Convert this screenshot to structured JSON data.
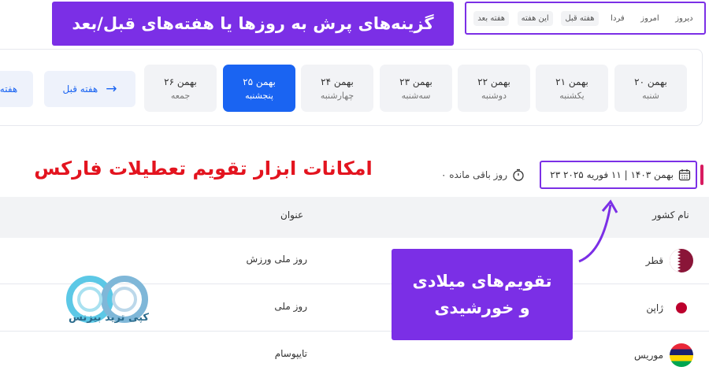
{
  "quick_nav": {
    "buttons": [
      "دیروز",
      "امروز",
      "فردا",
      "هفته قبل",
      "این هفته",
      "هفته بعد"
    ]
  },
  "callouts": {
    "top": "گزینه‌های پرش به روزها یا هفته‌های قبل/بعد",
    "calendar_line1": "تقویم‌های میلادی",
    "calendar_line2": "و خورشیدی",
    "features_title": "امکانات ابزار تقویم تعطیلات فارکس"
  },
  "days": [
    {
      "date": "۲۰ بهمن",
      "weekday": "شنبه"
    },
    {
      "date": "۲۱ بهمن",
      "weekday": "یکشنبه"
    },
    {
      "date": "۲۲ بهمن",
      "weekday": "دوشنبه"
    },
    {
      "date": "۲۳ بهمن",
      "weekday": "سه‌شنبه"
    },
    {
      "date": "۲۴ بهمن",
      "weekday": "چهارشنبه"
    },
    {
      "date": "۲۵ بهمن",
      "weekday": "پنجشنبه",
      "active": true
    },
    {
      "date": "۲۶ بهمن",
      "weekday": "جمعه"
    }
  ],
  "week_nav": {
    "prev_label": "هفته قبل",
    "next_label": "هفته"
  },
  "date_header": {
    "text": "۲۳ بهمن ۱۴۰۳ | ۱۱ فوریه ۲۰۲۵",
    "remaining": "۰ روز باقی مانده"
  },
  "table": {
    "col_country": "نام کشور",
    "col_title": "عنوان",
    "rows": [
      {
        "country": "قطر",
        "title": "روز ملی ورزش"
      },
      {
        "country": "ژاپن",
        "title": "روز ملی"
      },
      {
        "country": "موریس",
        "title": "تایپوسام"
      }
    ]
  },
  "logo": {
    "text": "کپی ترید بیزنس"
  },
  "colors": {
    "accent": "#7b2fe6",
    "primary": "#1a64f2",
    "red": "#e3141f"
  }
}
